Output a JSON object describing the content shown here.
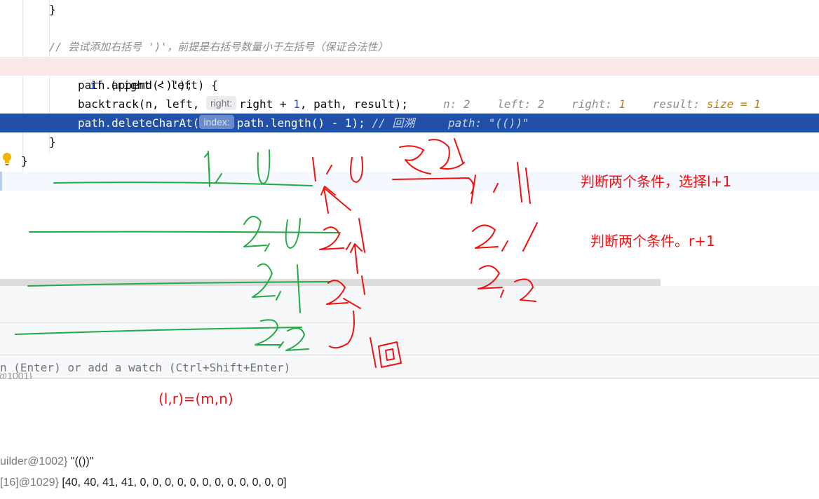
{
  "editor": {
    "lines": {
      "close_brace_1": "}",
      "comment": "// 尝试添加右括号 ')'，前提是右括号数量小于左括号（保证合法性）",
      "if_keyword": "if",
      "if_rest": " (right < left) {",
      "append": "path.append(')');",
      "backtrack_a": "backtrack(n, left, ",
      "backtrack_hint": "right:",
      "backtrack_b": "right + ",
      "backtrack_num": "1",
      "backtrack_c": ", path, result);",
      "delete_a": "path.deleteCharAt(",
      "delete_hint": "index:",
      "delete_b": "path.length() - ",
      "delete_num": "1",
      "delete_c": "); ",
      "delete_comment": "// 回溯",
      "close_brace_2": "}",
      "close_brace_3": "}"
    },
    "debug_values": {
      "n": "n: 2",
      "left": "left: 2",
      "right_label": "right: ",
      "right_val": "1",
      "result_label": "result: ",
      "result_val": "size = 1",
      "path": "path: \"(())\""
    }
  },
  "evaluate": {
    "placeholder": "n (Enter) or add a watch (Ctrl+Shift+Enter)"
  },
  "variables": {
    "fragment": "@1001}",
    "row1_ref": "uilder@1002}",
    "row1_value": " \"(())\"",
    "row2_ref": "[16]@1029}",
    "row2_value": " [40, 40, 41, 41, 0, 0, 0, 0, 0, 0, 0, 0, 0, 0, 0, 0]"
  },
  "annotations": {
    "note1": "判断两个条件，选择l+1",
    "note2": "判断两个条件。r+1",
    "note3": "(l,r)=(m,n)",
    "colors": {
      "red_ink": "#ee1111",
      "green_ink": "#22aa44"
    }
  }
}
